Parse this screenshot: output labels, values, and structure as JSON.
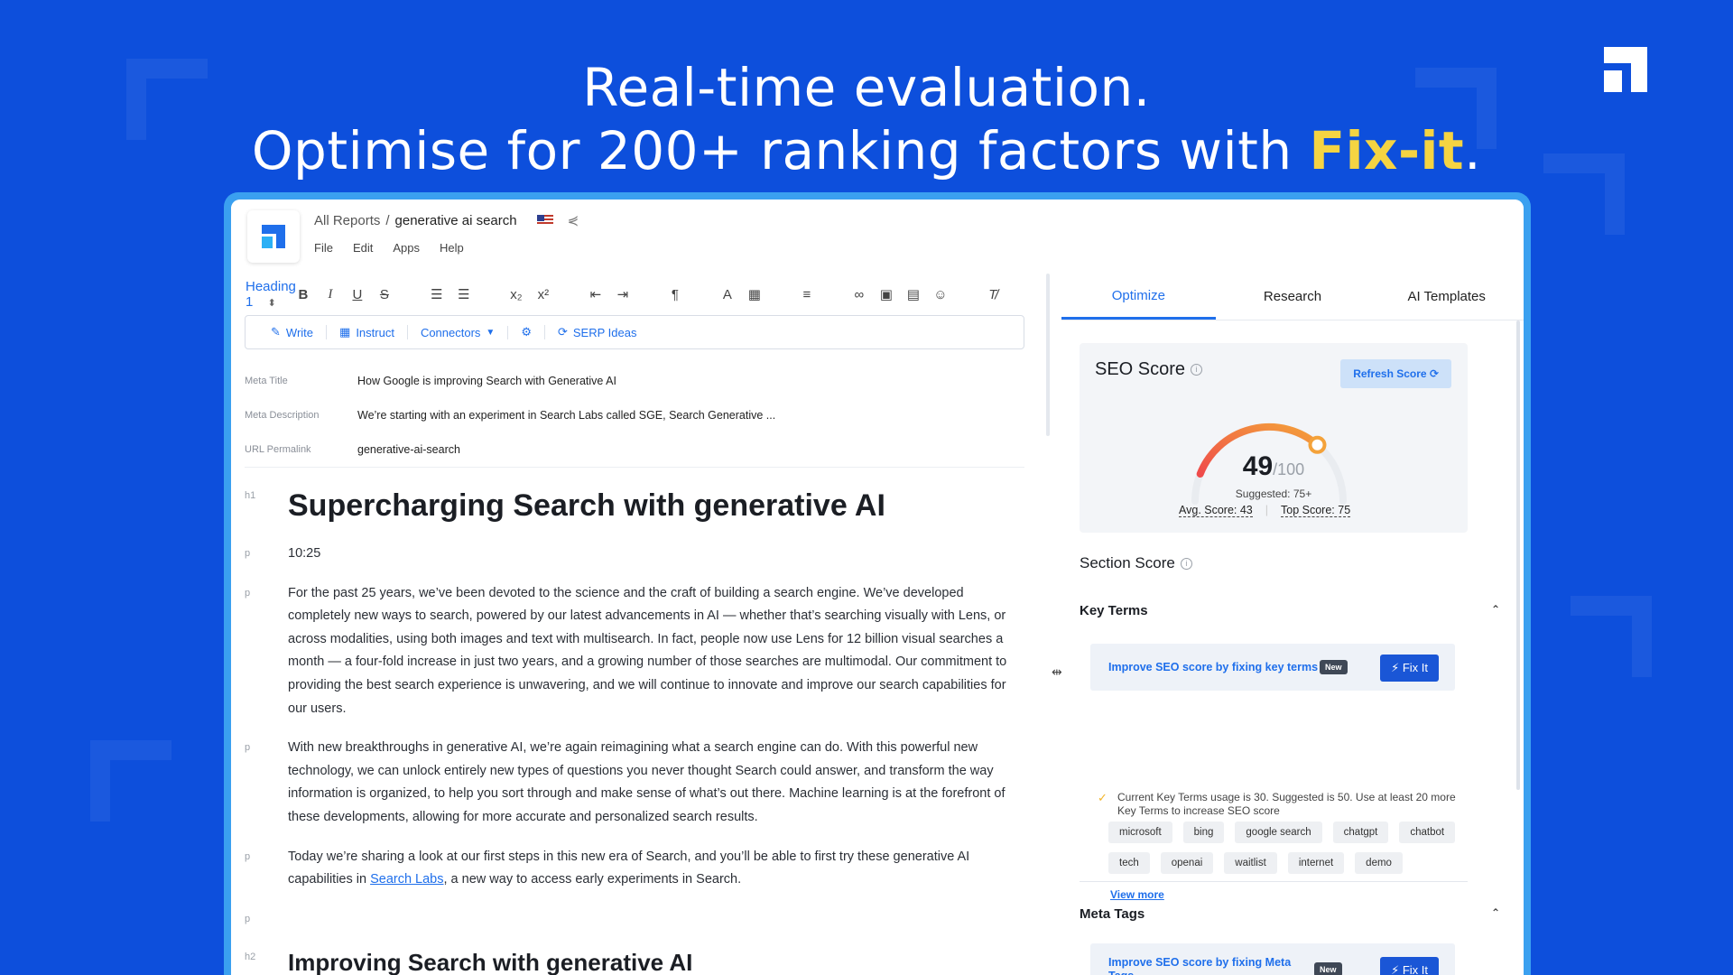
{
  "hero": {
    "line1": "Real-time evaluation.",
    "line2_prefix": "Optimise for 200+ ranking factors with ",
    "line2_highlight": "Fix-it",
    "line2_suffix": "."
  },
  "colors": {
    "background": "#0d4fdc",
    "accent": "#1f6feb",
    "highlight": "#f5d442",
    "frame": "#3aa0f0"
  },
  "breadcrumb": {
    "root": "All Reports",
    "sep": "/",
    "current": "generative ai search"
  },
  "menu": [
    "File",
    "Edit",
    "Apps",
    "Help"
  ],
  "toolbar": {
    "heading": "Heading 1"
  },
  "actions": {
    "write": "Write",
    "instruct": "Instruct",
    "connectors": "Connectors",
    "serp": "SERP Ideas"
  },
  "meta": {
    "title_label": "Meta Title",
    "title_value": "How Google is improving Search with Generative AI",
    "desc_label": "Meta Description",
    "desc_value": "We’re starting with an experiment in Search Labs called SGE, Search Generative ...",
    "url_label": "URL Permalink",
    "url_value": "generative-ai-search"
  },
  "doc": {
    "h1_tag": "h1",
    "h1": "Supercharging Search with generative AI",
    "p_tag": "p",
    "time": "10:25",
    "p1": "For the past 25 years, we’ve been devoted to the science and the craft of building a search engine. We’ve developed completely new ways to search, powered by our latest advancements in AI — whether that’s searching visually with Lens, or across modalities, using both images and text with multisearch. In fact, people now use Lens for 12 billion visual searches a month — a four-fold increase in just two years, and a growing number of those searches are multimodal. Our commitment to providing the best search experience is unwavering, and we will continue to innovate and improve our search capabilities for our users.",
    "p2": "With new breakthroughs in generative AI, we’re again reimagining what a search engine can do. With this powerful new technology, we can unlock entirely new types of questions you never thought Search could answer, and transform the way information is organized, to help you sort through and make sense of what’s out there. Machine learning is at the forefront of these developments, allowing for more accurate and personalized search results.",
    "p3_a": "Today we’re sharing a look at our first steps in this new era of Search, and you’ll be able to first try these generative AI capabilities in ",
    "p3_link": "Search Labs",
    "p3_b": ", a new way to access early experiments in Search.",
    "h2_tag": "h2",
    "h2": "Improving Search with generative AI"
  },
  "tabs": [
    "Optimize",
    "Research",
    "AI Templates"
  ],
  "seo": {
    "title": "SEO Score",
    "refresh": "Refresh Score",
    "score": "49",
    "max": "/100",
    "score_value": 49,
    "suggested": "Suggested: 75+",
    "avg": "Avg. Score: 43",
    "top": "Top Score: 75"
  },
  "section": {
    "title": "Section Score",
    "key_terms": "Key Terms",
    "meta_tags": "Meta Tags"
  },
  "fix": {
    "key_text": "Improve SEO score by fixing key terms",
    "meta_text": "Improve SEO score by fixing Meta Tags",
    "new": "New",
    "button": "Fix It"
  },
  "usage": "Current Key Terms usage is 30. Suggested is 50. Use at least 20 more Key Terms to increase SEO score",
  "chips": [
    "microsoft",
    "bing",
    "google search",
    "chatgpt",
    "chatbot",
    "tech",
    "openai",
    "waitlist",
    "internet",
    "demo"
  ],
  "view_more": "View more"
}
